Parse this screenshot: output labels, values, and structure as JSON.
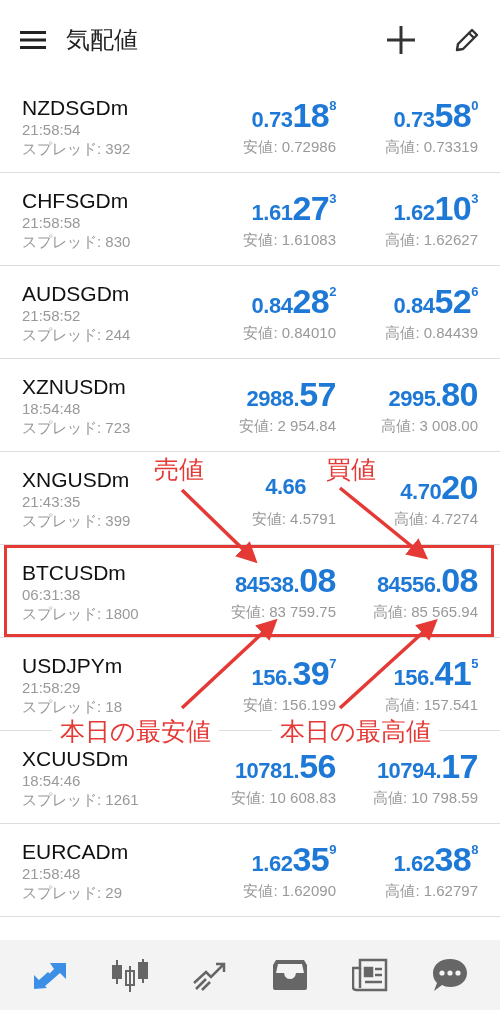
{
  "header": {
    "title": "気配値"
  },
  "rows": [
    {
      "name": "NZDSGDm",
      "time": "21:58:54",
      "spread": "スプレッド: 392",
      "bid": {
        "prefix": "0.73",
        "big": "18",
        "sup": "8"
      },
      "ask": {
        "prefix": "0.73",
        "big": "58",
        "sup": "0"
      },
      "low": "安値: 0.72986",
      "high": "高値: 0.73319",
      "highlighted": false
    },
    {
      "name": "CHFSGDm",
      "time": "21:58:58",
      "spread": "スプレッド: 830",
      "bid": {
        "prefix": "1.61",
        "big": "27",
        "sup": "3"
      },
      "ask": {
        "prefix": "1.62",
        "big": "10",
        "sup": "3"
      },
      "low": "安値: 1.61083",
      "high": "高値: 1.62627",
      "highlighted": false
    },
    {
      "name": "AUDSGDm",
      "time": "21:58:52",
      "spread": "スプレッド: 244",
      "bid": {
        "prefix": "0.84",
        "big": "28",
        "sup": "2"
      },
      "ask": {
        "prefix": "0.84",
        "big": "52",
        "sup": "6"
      },
      "low": "安値: 0.84010",
      "high": "高値: 0.84439",
      "highlighted": false
    },
    {
      "name": "XZNUSDm",
      "time": "18:54:48",
      "spread": "スプレッド: 723",
      "bid": {
        "prefix": "2988.",
        "big": "57"
      },
      "ask": {
        "prefix": "2995.",
        "big": "80"
      },
      "low": "安値: 2 954.84",
      "high": "高値: 3 008.00",
      "highlighted": false
    },
    {
      "name": "XNGUSDm",
      "time": "21:43:35",
      "spread": "スプレッド: 399",
      "bid": {
        "prefix": "4.66"
      },
      "ask": {
        "prefix": "4.70",
        "big": "20"
      },
      "low": "安値: 4.5791",
      "high": "高値: 4.7274",
      "highlighted": false
    },
    {
      "name": "BTCUSDm",
      "time": "06:31:38",
      "spread": "スプレッド: 1800",
      "bid": {
        "prefix": "84538.",
        "big": "08"
      },
      "ask": {
        "prefix": "84556.",
        "big": "08"
      },
      "low": "安値: 83 759.75",
      "high": "高値: 85 565.94",
      "highlighted": true
    },
    {
      "name": "USDJPYm",
      "time": "21:58:29",
      "spread": "スプレッド: 18",
      "bid": {
        "prefix": "156.",
        "big": "39",
        "sup": "7"
      },
      "ask": {
        "prefix": "156.",
        "big": "41",
        "sup": "5"
      },
      "low": "安値: 156.199",
      "high": "高値: 157.541",
      "highlighted": false
    },
    {
      "name": "XCUUSDm",
      "time": "18:54:46",
      "spread": "スプレッド: 1261",
      "bid": {
        "prefix": "10781.",
        "big": "56"
      },
      "ask": {
        "prefix": "10794.",
        "big": "17"
      },
      "low": "安値: 10 608.83",
      "high": "高値: 10 798.59",
      "highlighted": false
    },
    {
      "name": "EURCADm",
      "time": "21:58:48",
      "spread": "スプレッド: 29",
      "bid": {
        "prefix": "1.62",
        "big": "35",
        "sup": "9"
      },
      "ask": {
        "prefix": "1.62",
        "big": "38",
        "sup": "8"
      },
      "low": "安値: 1.62090",
      "high": "高値: 1.62797",
      "highlighted": false
    }
  ],
  "annotations": [
    {
      "text": "売値",
      "kind": "top-left"
    },
    {
      "text": "買値",
      "kind": "top-right"
    },
    {
      "text": "本日の最安値",
      "kind": "bottom-left"
    },
    {
      "text": "本日の最高値",
      "kind": "bottom-right"
    }
  ],
  "nav": [
    {
      "kind": "arrows",
      "selected": true
    },
    {
      "kind": "candles",
      "selected": false
    },
    {
      "kind": "trend",
      "selected": false
    },
    {
      "kind": "inbox",
      "selected": false
    },
    {
      "kind": "news",
      "selected": false
    },
    {
      "kind": "chat",
      "selected": false
    }
  ]
}
